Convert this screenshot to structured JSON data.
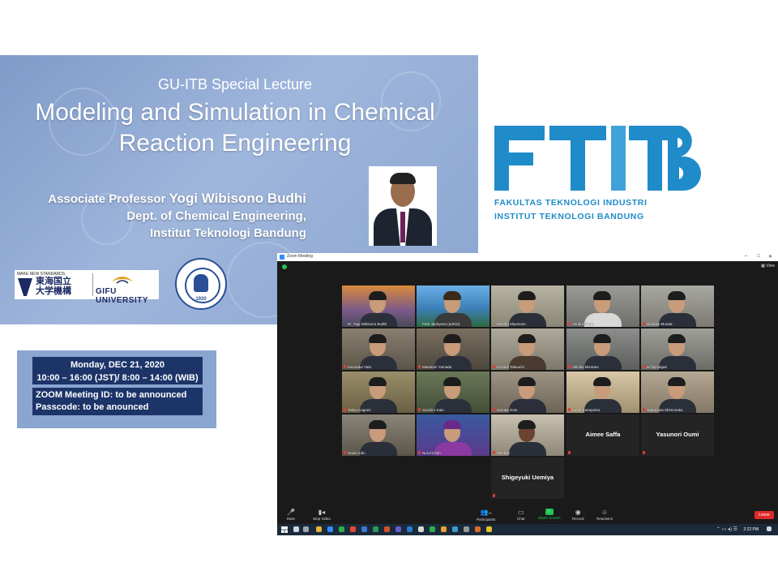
{
  "poster": {
    "subtitle": "GU-ITB Special Lecture",
    "title_line1": "Modeling and Simulation in Chemical",
    "title_line2": "Reaction Engineering",
    "prof_prefix": "Associate Professor ",
    "prof_name": "Yogi Wibisono Budhi",
    "dept": "Dept. of Chemical Engineering,",
    "institute": "Institut Teknologi Bandung",
    "logo_tagline": "MAKE NEW STANDARDS.",
    "logo_kanji_1": "東海国立",
    "logo_kanji_2": "大学機構",
    "logo_gifu": "GIFU UNIVERSITY",
    "seal_year": "1920"
  },
  "info": {
    "date_line1": "Monday, DEC 21, 2020",
    "date_line2": "10:00 – 16:00 (JST)/ 8:00 – 14:00 (WIB)",
    "zoom_id": "ZOOM Meeting ID: to be announced",
    "passcode": "Passcode: to be anounced"
  },
  "ftitb": {
    "mark": "FTITB",
    "line1": "FAKULTAS TEKNOLOGI INDUSTRI",
    "line2": "INSTITUT TEKNOLOGI BANDUNG",
    "color": "#1f8bc9"
  },
  "zoom": {
    "window_title": "Zoom Meeting",
    "view_label": "View",
    "participants": [
      {
        "name": "Dr. Yogi Wibisono Budhi"
      },
      {
        "name": "Park Jaehyeon (admin)"
      },
      {
        "name": "Masaru Miyamoto"
      },
      {
        "name": "Asuki Kohara"
      },
      {
        "name": "Daisuke Murata"
      },
      {
        "name": "Kazutaka Yata"
      },
      {
        "name": "Masanori Yamada"
      },
      {
        "name": "Kosuke Takeuchi"
      },
      {
        "name": "Akihiko Mizutani"
      },
      {
        "name": "ar-fujimagari"
      },
      {
        "name": "Takao Kagami"
      },
      {
        "name": "Soichiro Kato"
      },
      {
        "name": "Haruka Goto"
      },
      {
        "name": "Yuhei Kanayama"
      },
      {
        "name": "Tadamasa Shimonaka"
      },
      {
        "name": "Naoki Kido"
      },
      {
        "name": "Nurul Izzah"
      },
      {
        "name": "Merikah"
      },
      {
        "name": "Aimee Saffa"
      },
      {
        "name": "Yasunori Oumi"
      },
      {
        "name": "Shigeyuki Uemiya"
      }
    ],
    "toolbar": {
      "mute": "Mute",
      "stop_video": "Stop Video",
      "participants": "Participants",
      "participants_count": "21",
      "chat": "Chat",
      "share_screen": "Share Screen",
      "record": "Record",
      "reactions": "Reactions",
      "leave": "Leave"
    },
    "clock": "2:22 PM"
  }
}
